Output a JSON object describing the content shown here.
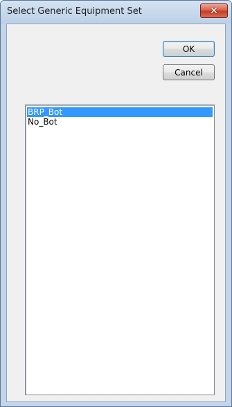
{
  "window": {
    "title": "Select Generic Equipment Set",
    "close_glyph": "✕"
  },
  "buttons": {
    "ok_label": "OK",
    "cancel_label": "Cancel"
  },
  "list": {
    "items": [
      "BRP_Bot",
      "No_Bot"
    ],
    "selected_index": 0
  },
  "colors": {
    "selection": "#3399ff",
    "close_button": "#c33d25"
  }
}
